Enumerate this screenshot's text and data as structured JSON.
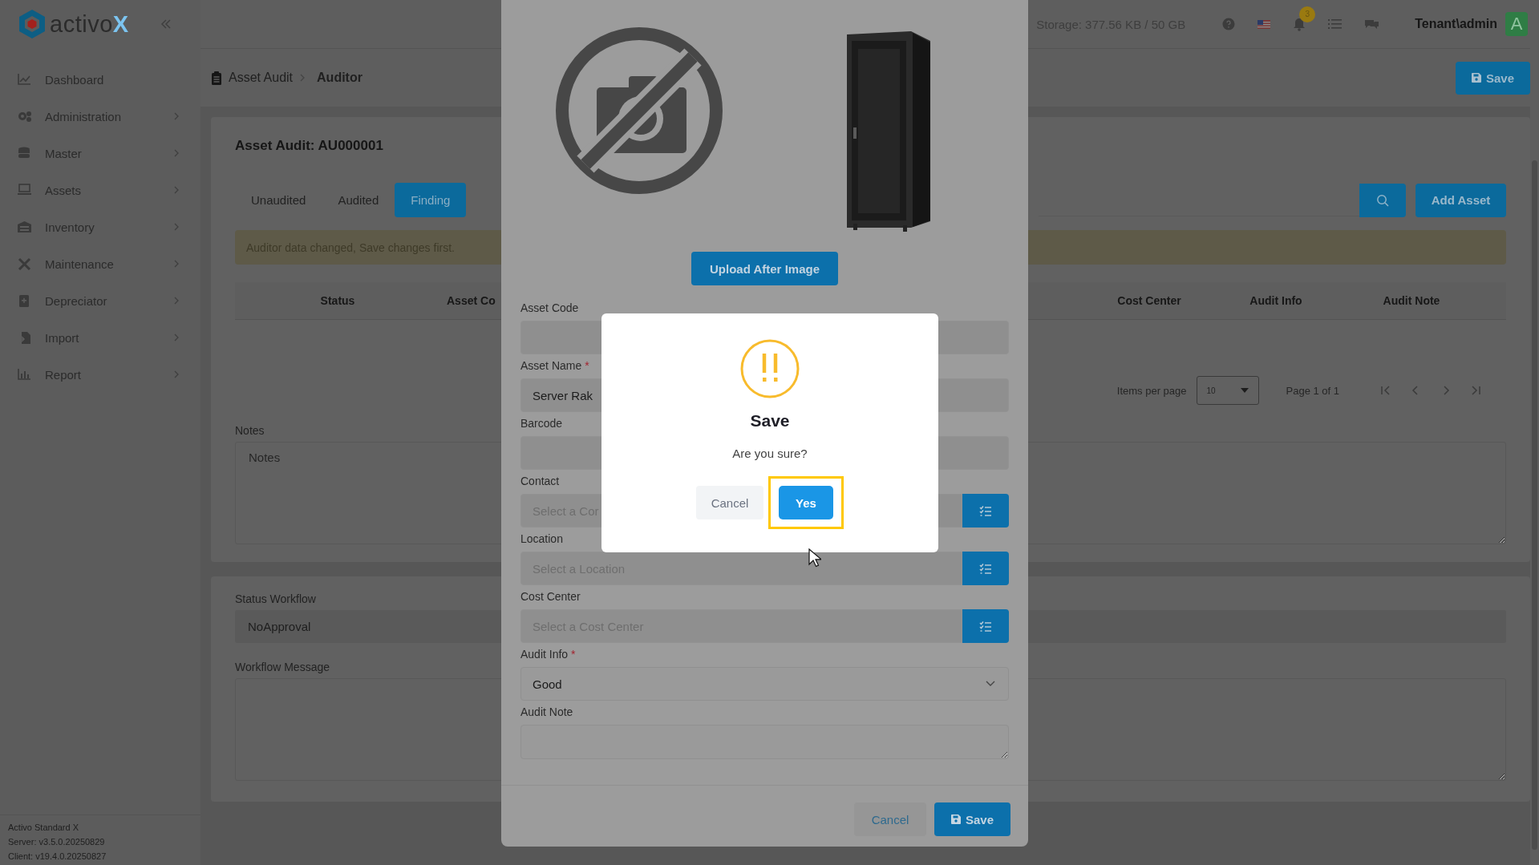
{
  "sidebar": {
    "logo": {
      "text": "activo",
      "accent": "X"
    },
    "items": [
      {
        "label": "Dashboard",
        "kind": "chart",
        "expandable": false
      },
      {
        "label": "Administration",
        "kind": "gears",
        "expandable": true
      },
      {
        "label": "Master",
        "kind": "database",
        "expandable": true
      },
      {
        "label": "Assets",
        "kind": "laptop",
        "expandable": true
      },
      {
        "label": "Inventory",
        "kind": "warehouse",
        "expandable": true
      },
      {
        "label": "Maintenance",
        "kind": "tools",
        "expandable": true
      },
      {
        "label": "Depreciator",
        "kind": "calculator",
        "expandable": true
      },
      {
        "label": "Import",
        "kind": "import",
        "expandable": true
      },
      {
        "label": "Report",
        "kind": "bars",
        "expandable": true
      }
    ],
    "footer": [
      "Activo Standard X",
      "Server: v3.5.0.20250829",
      "Client: v19.4.0.20250827"
    ]
  },
  "top_bar": {
    "storage": "Storage: 377.56 KB / 50 GB",
    "notification_count": "3",
    "user": "Tenant\\admin",
    "avatar": "A"
  },
  "breadcrumb": [
    "Asset Audit",
    "Auditor"
  ],
  "header_button": "Save",
  "audit": {
    "title": "Asset Audit: AU000001",
    "tabs": [
      {
        "label": "Unaudited",
        "selected": false
      },
      {
        "label": "Audited",
        "selected": false
      },
      {
        "label": "Finding",
        "selected": true
      }
    ],
    "add_button": "Add Asset",
    "alert": "Auditor data changed, Save changes first.",
    "columns": [
      "Status",
      "Asset Co",
      "Cost Center",
      "Audit Info",
      "Audit Note"
    ],
    "pagination": {
      "label": "Items per page",
      "page_size": "10",
      "page_info": "Page 1 of 1"
    },
    "notes": {
      "label": "Notes",
      "placeholder": "Notes"
    }
  },
  "workflow": {
    "status_label": "Status Workflow",
    "status_value": "NoApproval",
    "message_label": "Workflow Message"
  },
  "edit_dialog": {
    "upload_button": "Upload After Image",
    "fields": [
      {
        "label": "Asset Code",
        "kind": "text"
      },
      {
        "label": "Asset Name",
        "required_mark": "*",
        "kind": "text",
        "value": "Server Rak"
      },
      {
        "label": "Barcode",
        "kind": "text"
      },
      {
        "label": "Contact",
        "kind": "lookup",
        "placeholder": "Select a Cor"
      },
      {
        "label": "Location",
        "kind": "lookup",
        "placeholder": "Select a Location"
      },
      {
        "label": "Cost Center",
        "kind": "lookup",
        "placeholder": "Select a Cost Center"
      },
      {
        "label": "Audit Info",
        "required_mark": "*",
        "kind": "select",
        "value": "Good"
      },
      {
        "label": "Audit Note",
        "kind": "textarea"
      }
    ],
    "cancel": "Cancel",
    "save": "Save"
  },
  "confirm_dialog": {
    "title": "Save",
    "message": "Are you sure?",
    "cancel": "Cancel",
    "confirm": "Yes",
    "highlighted": true
  }
}
